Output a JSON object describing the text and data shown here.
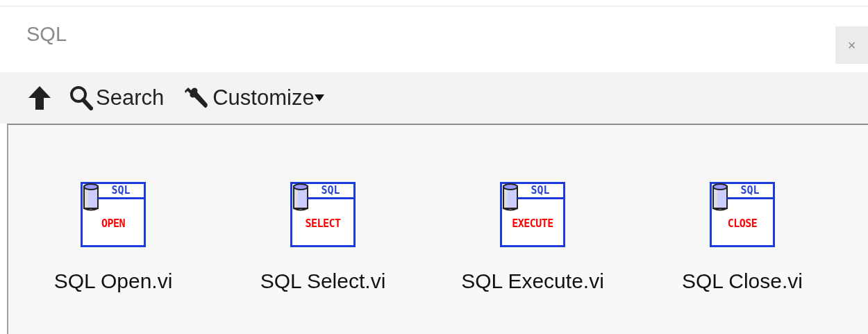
{
  "window": {
    "title": "SQL",
    "close_label": "×"
  },
  "toolbar": {
    "search_label": "Search",
    "customize_label": "Customize"
  },
  "items": [
    {
      "header": "SQL",
      "icon_text": "OPEN",
      "label": "SQL Open.vi"
    },
    {
      "header": "SQL",
      "icon_text": "SELECT",
      "label": "SQL Select.vi"
    },
    {
      "header": "SQL",
      "icon_text": "EXECUTE",
      "label": "SQL Execute.vi"
    },
    {
      "header": "SQL",
      "icon_text": "CLOSE",
      "label": "SQL Close.vi"
    }
  ]
}
